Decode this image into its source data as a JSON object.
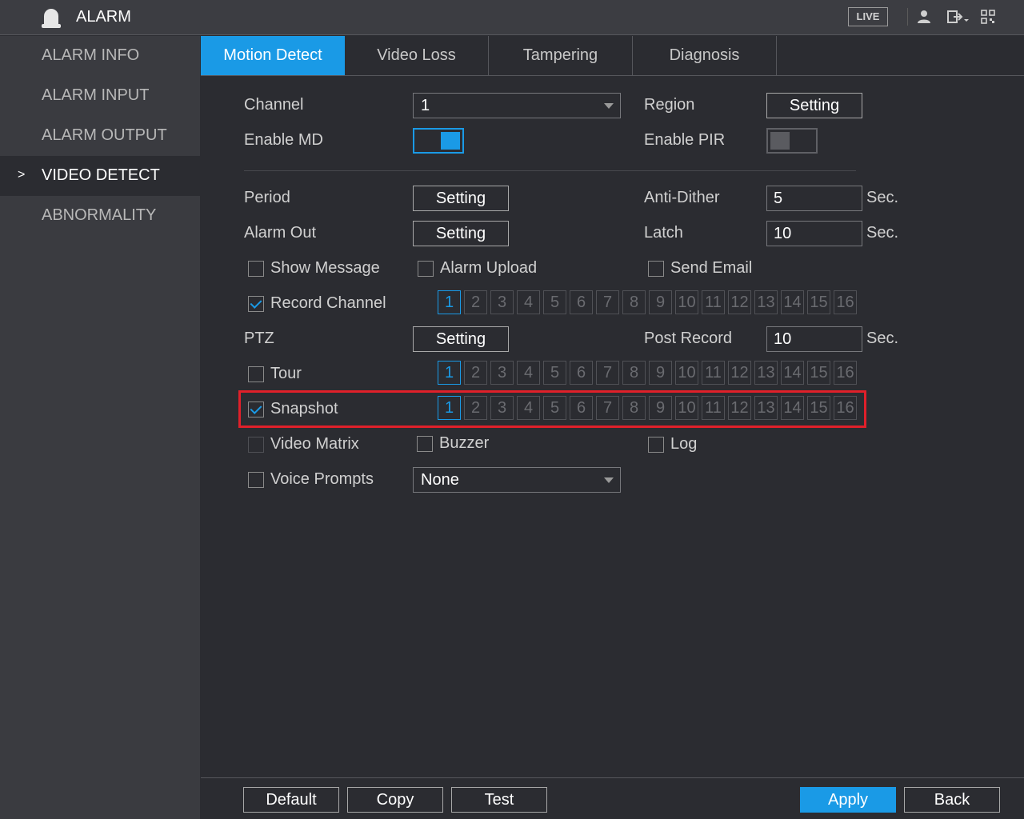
{
  "header": {
    "title": "ALARM",
    "live_label": "LIVE",
    "icons": [
      "alarm-bell-icon",
      "user-icon",
      "logout-icon",
      "qr-code-icon"
    ]
  },
  "sidebar": {
    "items": [
      {
        "label": "ALARM INFO",
        "active": false
      },
      {
        "label": "ALARM INPUT",
        "active": false
      },
      {
        "label": "ALARM OUTPUT",
        "active": false
      },
      {
        "label": "VIDEO DETECT",
        "active": true
      },
      {
        "label": "ABNORMALITY",
        "active": false
      }
    ],
    "active_marker": ">"
  },
  "tabs": [
    {
      "label": "Motion Detect",
      "active": true
    },
    {
      "label": "Video Loss",
      "active": false
    },
    {
      "label": "Tampering",
      "active": false
    },
    {
      "label": "Diagnosis",
      "active": false
    }
  ],
  "form": {
    "channel": {
      "label": "Channel",
      "value": "1"
    },
    "region": {
      "label": "Region",
      "button": "Setting"
    },
    "enable_md": {
      "label": "Enable MD",
      "on": true
    },
    "enable_pir": {
      "label": "Enable PIR",
      "on": false
    },
    "period": {
      "label": "Period",
      "button": "Setting"
    },
    "anti_dither": {
      "label": "Anti-Dither",
      "value": "5",
      "unit": "Sec."
    },
    "alarm_out": {
      "label": "Alarm Out",
      "button": "Setting"
    },
    "latch": {
      "label": "Latch",
      "value": "10",
      "unit": "Sec."
    },
    "show_message": {
      "label": "Show Message",
      "checked": false
    },
    "alarm_upload": {
      "label": "Alarm Upload",
      "checked": false
    },
    "send_email": {
      "label": "Send Email",
      "checked": false
    },
    "record_channel": {
      "label": "Record Channel",
      "checked": true,
      "selected": [
        1
      ]
    },
    "ptz": {
      "label": "PTZ",
      "button": "Setting"
    },
    "post_record": {
      "label": "Post Record",
      "value": "10",
      "unit": "Sec."
    },
    "tour": {
      "label": "Tour",
      "checked": false,
      "selected": [
        1
      ]
    },
    "snapshot": {
      "label": "Snapshot",
      "checked": true,
      "selected": [
        1
      ]
    },
    "video_matrix": {
      "label": "Video Matrix",
      "checked": false
    },
    "buzzer": {
      "label": "Buzzer",
      "checked": false
    },
    "log": {
      "label": "Log",
      "checked": false
    },
    "voice_prompts": {
      "label": "Voice Prompts",
      "checked": false,
      "value": "None"
    },
    "channels": [
      "1",
      "2",
      "3",
      "4",
      "5",
      "6",
      "7",
      "8",
      "9",
      "10",
      "11",
      "12",
      "13",
      "14",
      "15",
      "16"
    ]
  },
  "footer": {
    "default_label": "Default",
    "copy_label": "Copy",
    "test_label": "Test",
    "apply_label": "Apply",
    "back_label": "Back"
  },
  "colors": {
    "accent": "#1a9ae6",
    "background": "#2b2c31",
    "sidebar": "#3a3b40",
    "highlight_box": "#e0202a"
  }
}
